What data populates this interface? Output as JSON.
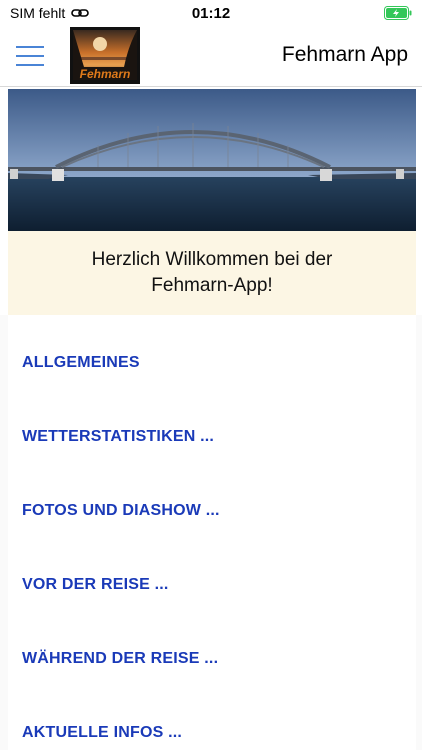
{
  "status_bar": {
    "carrier": "SIM fehlt",
    "time": "01:12",
    "icons": [
      "link-icon",
      "battery-charging-icon"
    ]
  },
  "nav": {
    "title": "Fehmarn App",
    "logo_text": "Fehmarn",
    "menu_icon": "hamburger-icon"
  },
  "welcome": {
    "line1": "Herzlich Willkommen bei der",
    "line2": "Fehmarn-App!"
  },
  "menu": [
    {
      "label": "ALLGEMEINES"
    },
    {
      "label": "WETTERSTATISTIKEN ..."
    },
    {
      "label": "FOTOS UND DIASHOW ..."
    },
    {
      "label": "VOR DER REISE ..."
    },
    {
      "label": "WÄHREND DER REISE ..."
    },
    {
      "label": "AKTUELLE INFOS ..."
    }
  ],
  "colors": {
    "link": "#1a3ab8",
    "accent": "#4a84d6",
    "welcome_bg": "#fcf6e4",
    "battery": "#34c759"
  }
}
